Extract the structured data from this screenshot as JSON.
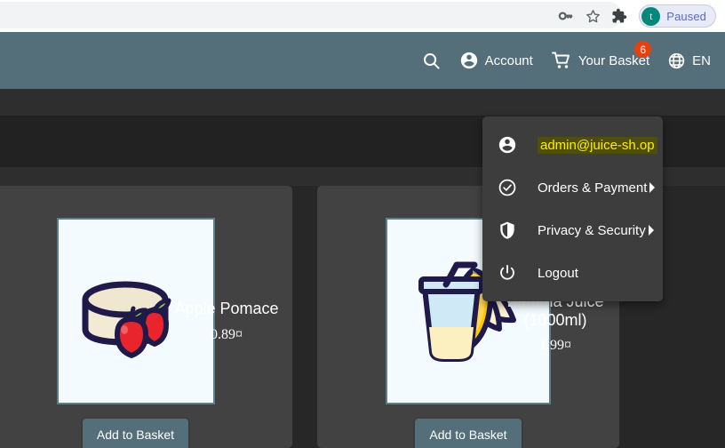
{
  "browser": {
    "icons": [
      {
        "name": "key-icon",
        "glyph": "key"
      },
      {
        "name": "bookmark-star-icon",
        "glyph": "star"
      },
      {
        "name": "extensions-puzzle-icon",
        "glyph": "puzzle"
      }
    ],
    "profile_chip": {
      "avatar_initial": "t",
      "label": "Paused",
      "avatar_color": "#00897b",
      "chip_bg": "#e8eaf6",
      "label_color": "#5c6bc0"
    }
  },
  "app": {
    "toolbar": {
      "background": "#546e7a",
      "search_label": "",
      "account_label": "Account",
      "basket_label": "Your Basket",
      "basket_badge": "6",
      "basket_badge_color": "#e8410e",
      "language_label": "EN"
    },
    "account_menu": {
      "background": "#3d3d3d",
      "items": [
        {
          "label": "admin@juice-sh.op",
          "icon": "account-circle-icon",
          "highlighted": true,
          "chevron": false
        },
        {
          "label": "Orders & Payment",
          "icon": "check-circle-icon",
          "highlighted": false,
          "chevron": true
        },
        {
          "label": "Privacy & Security",
          "icon": "shield-icon",
          "highlighted": false,
          "chevron": true
        },
        {
          "label": "Logout",
          "icon": "power-icon",
          "highlighted": false,
          "chevron": false
        }
      ],
      "highlight_bg": "#4f4f0a",
      "highlight_fg": "#ffef00"
    },
    "products": [
      {
        "name": "Apple Pomace",
        "price": "0.89¤",
        "image": "apple-pomace-image",
        "add_label": "Add to Basket"
      },
      {
        "name": "Banana Juice (1000ml)",
        "name_line1": "Banana Juice",
        "name_line2": "(1000ml)",
        "price": "1.99¤",
        "image": "banana-juice-image",
        "add_label": "Add to Basket"
      }
    ],
    "colors": {
      "card_bg": "#424242",
      "page_bg": "#262626",
      "button_bg": "#546e7a",
      "image_border": "#607d8b"
    }
  }
}
